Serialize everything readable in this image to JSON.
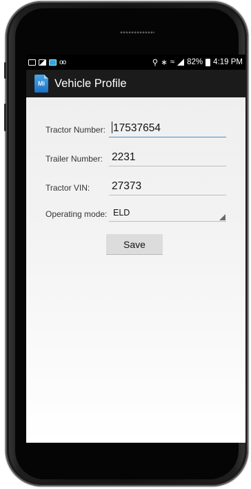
{
  "status_bar": {
    "voicemail": "oo",
    "battery": "82%",
    "time": "4:19 PM"
  },
  "app_bar": {
    "logo_text": "Mi",
    "title": "Vehicle Profile"
  },
  "form": {
    "tractor_number": {
      "label": "Tractor Number:",
      "value": "17537654"
    },
    "trailer_number": {
      "label": "Trailer Number:",
      "value": "2231"
    },
    "tractor_vin": {
      "label": "Tractor VIN:",
      "value": "27373"
    },
    "operating_mode": {
      "label": "Operating mode:",
      "selected": "ELD"
    }
  },
  "save_label": "Save"
}
